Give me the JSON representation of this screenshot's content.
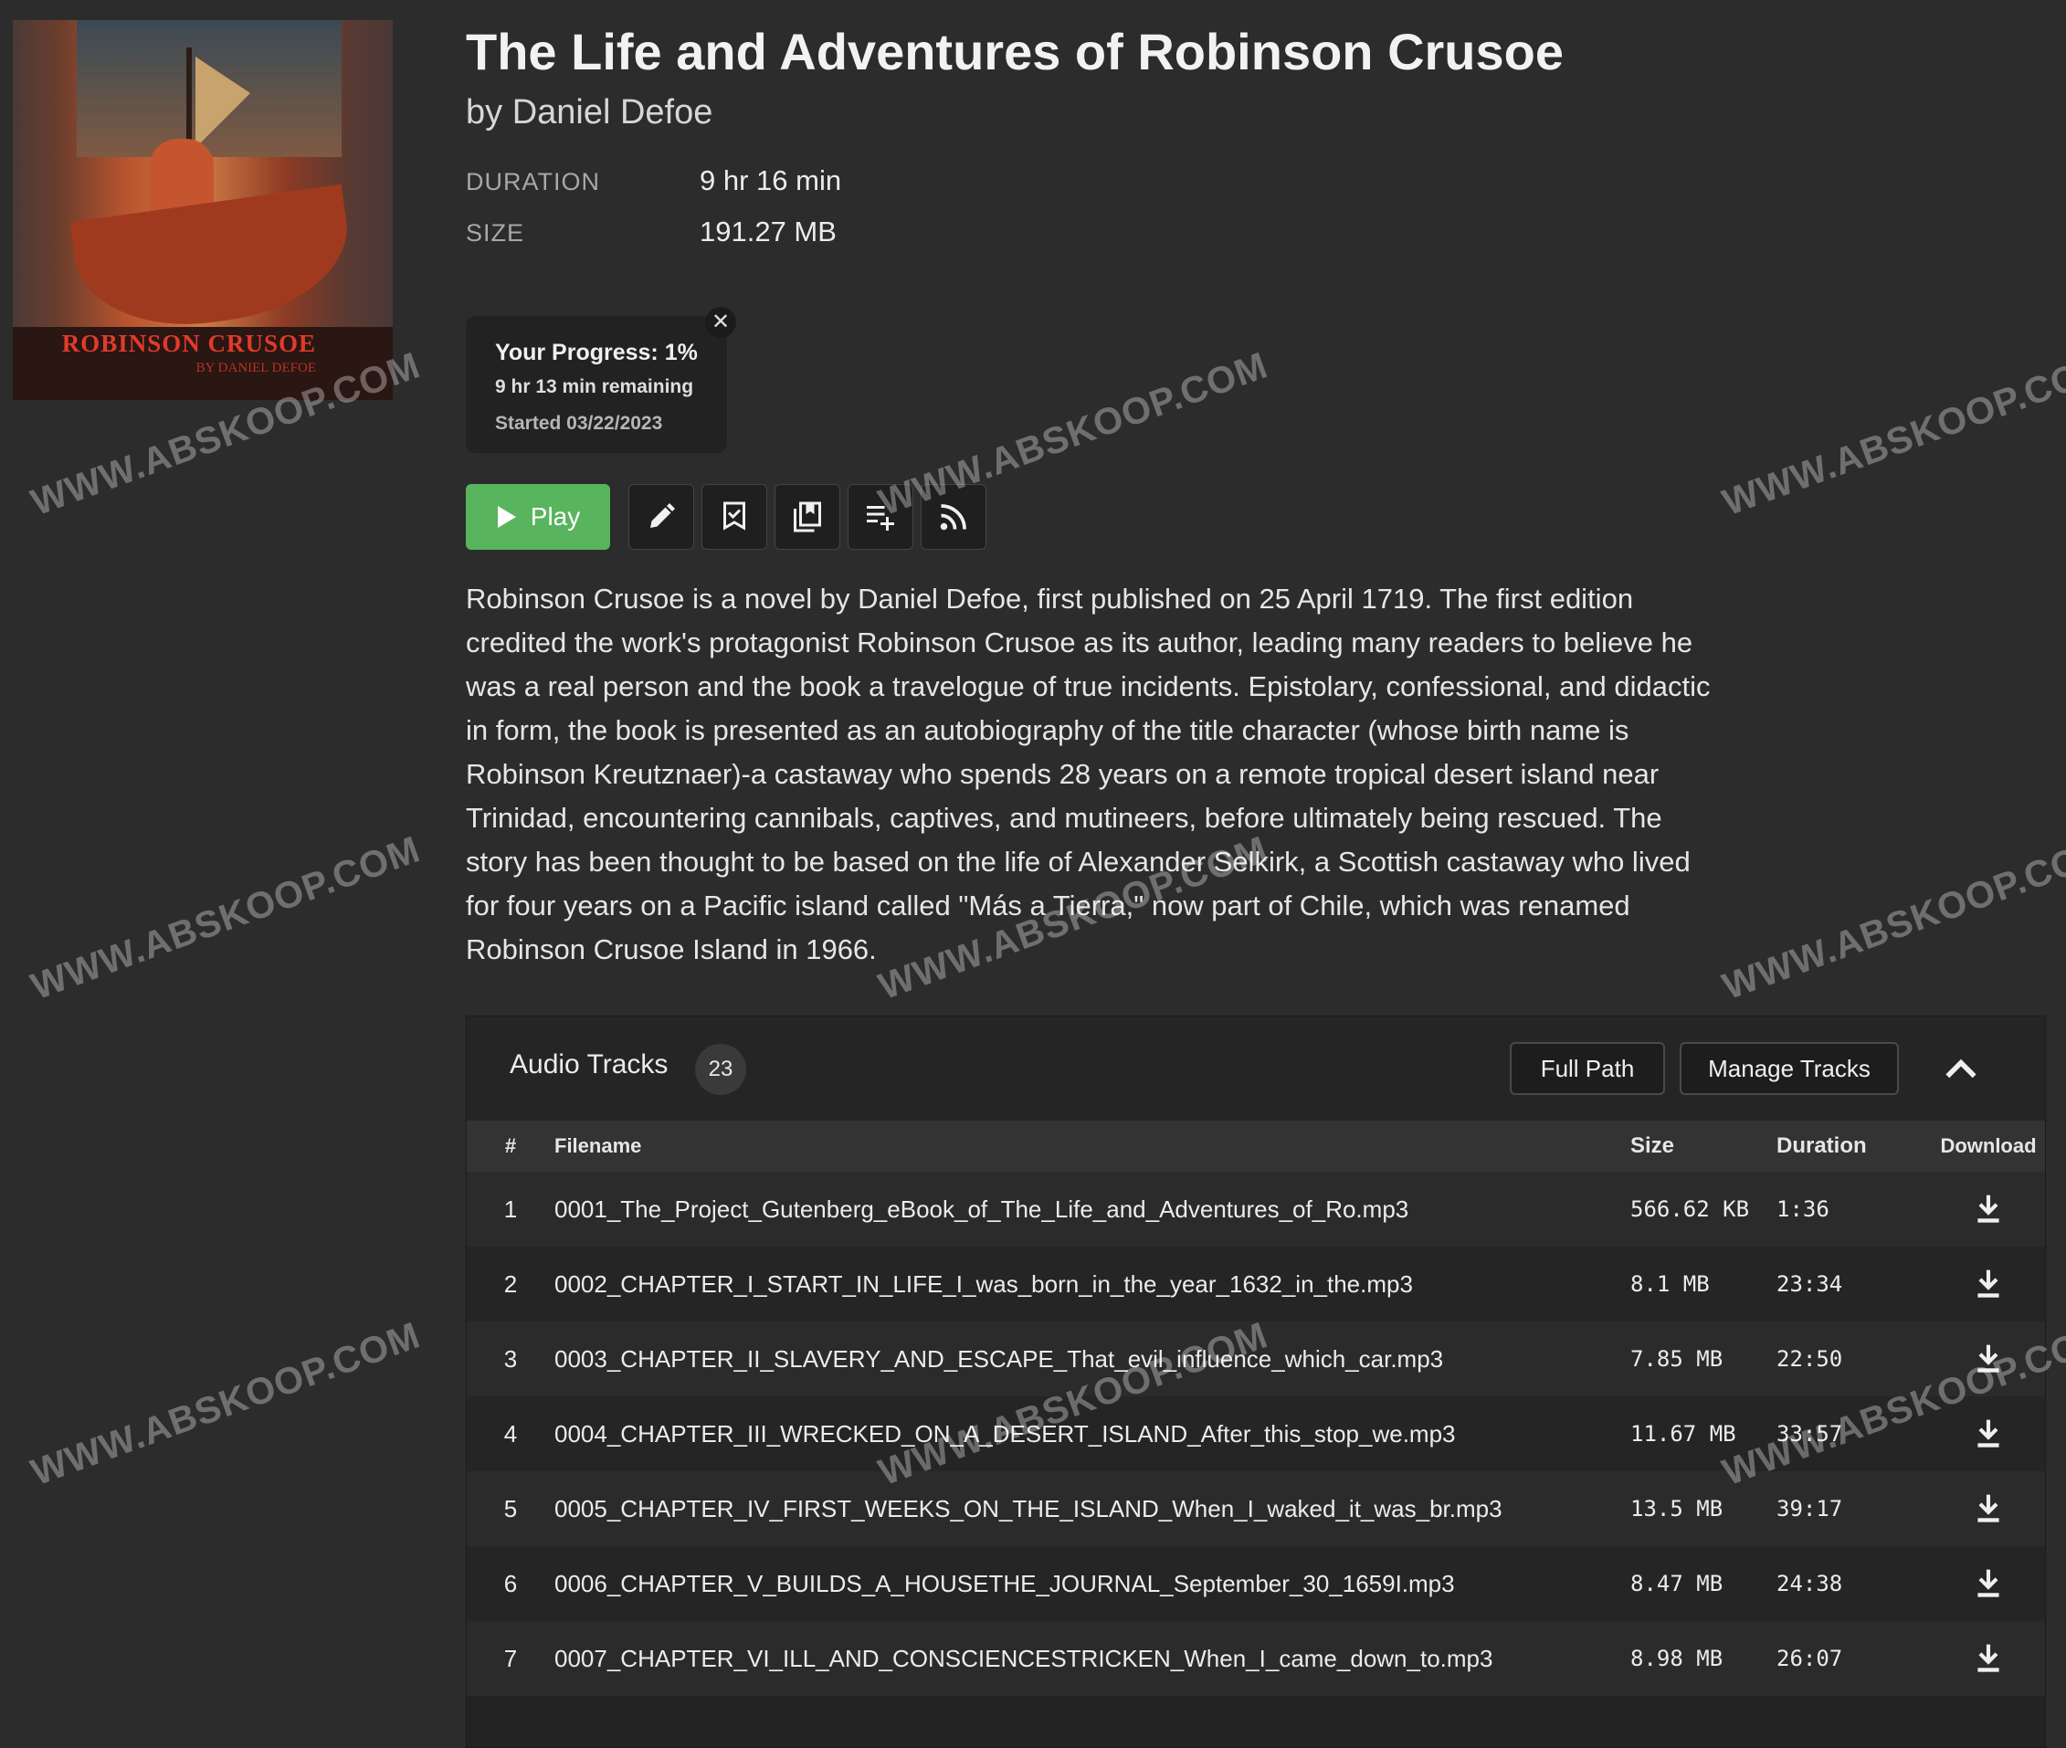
{
  "book": {
    "title": "The Life and Adventures of Robinson Crusoe",
    "author": "by Daniel Defoe",
    "cover_title": "ROBINSON CRUSOE",
    "cover_byline": "BY DANIEL DEFOE"
  },
  "meta": {
    "duration_label": "DURATION",
    "duration_value": "9 hr 16 min",
    "size_label": "SIZE",
    "size_value": "191.27 MB"
  },
  "progress": {
    "label": "Your Progress: 1%",
    "percent": 1,
    "remaining": "9 hr 13 min remaining",
    "started": "Started 03/22/2023",
    "close_glyph": "✕"
  },
  "actions": {
    "play_label": "Play",
    "icons": [
      "pencil-icon",
      "bookmark-check-icon",
      "collections-icon",
      "add-to-playlist-icon",
      "rss-feed-icon"
    ]
  },
  "description": "Robinson Crusoe is a novel by Daniel Defoe, first published on 25 April 1719. The first edition credited the work's protagonist Robinson Crusoe as its author, leading many readers to believe he was a real person and the book a travelogue of true incidents. Epistolary, confessional, and didactic in form, the book is presented as an autobiography of the title character (whose birth name is Robinson Kreutznaer)-a castaway who spends 28 years on a remote tropical desert island near Trinidad, encountering cannibals, captives, and mutineers, before ultimately being rescued. The story has been thought to be based on the life of Alexander Selkirk, a Scottish castaway who lived for four years on a Pacific island called \"Más a Tierra,\" now part of Chile, which was renamed Robinson Crusoe Island in 1966.",
  "tracks": {
    "title": "Audio Tracks",
    "count": "23",
    "full_path_label": "Full Path",
    "manage_label": "Manage Tracks",
    "columns": {
      "num": "#",
      "filename": "Filename",
      "size": "Size",
      "duration": "Duration",
      "download": "Download"
    },
    "rows": [
      {
        "num": "1",
        "filename": "0001_The_Project_Gutenberg_eBook_of_The_Life_and_Adventures_of_Ro.mp3",
        "size": "566.62 KB",
        "duration": "1:36"
      },
      {
        "num": "2",
        "filename": "0002_CHAPTER_I_START_IN_LIFE_I_was_born_in_the_year_1632_in_the.mp3",
        "size": "8.1 MB",
        "duration": "23:34"
      },
      {
        "num": "3",
        "filename": "0003_CHAPTER_II_SLAVERY_AND_ESCAPE_That_evil_influence_which_car.mp3",
        "size": "7.85 MB",
        "duration": "22:50"
      },
      {
        "num": "4",
        "filename": "0004_CHAPTER_III_WRECKED_ON_A_DESERT_ISLAND_After_this_stop_we.mp3",
        "size": "11.67 MB",
        "duration": "33:57"
      },
      {
        "num": "5",
        "filename": "0005_CHAPTER_IV_FIRST_WEEKS_ON_THE_ISLAND_When_I_waked_it_was_br.mp3",
        "size": "13.5 MB",
        "duration": "39:17"
      },
      {
        "num": "6",
        "filename": "0006_CHAPTER_V_BUILDS_A_HOUSETHE_JOURNAL_September_30_1659I.mp3",
        "size": "8.47 MB",
        "duration": "24:38"
      },
      {
        "num": "7",
        "filename": "0007_CHAPTER_VI_ILL_AND_CONSCIENCESTRICKEN_When_I_came_down_to.mp3",
        "size": "8.98 MB",
        "duration": "26:07"
      }
    ]
  },
  "watermark": "WWW.ABSKOOP.COM",
  "colors": {
    "background": "#2c2c2c",
    "play_green": "#59b45e",
    "panel": "#232323"
  }
}
